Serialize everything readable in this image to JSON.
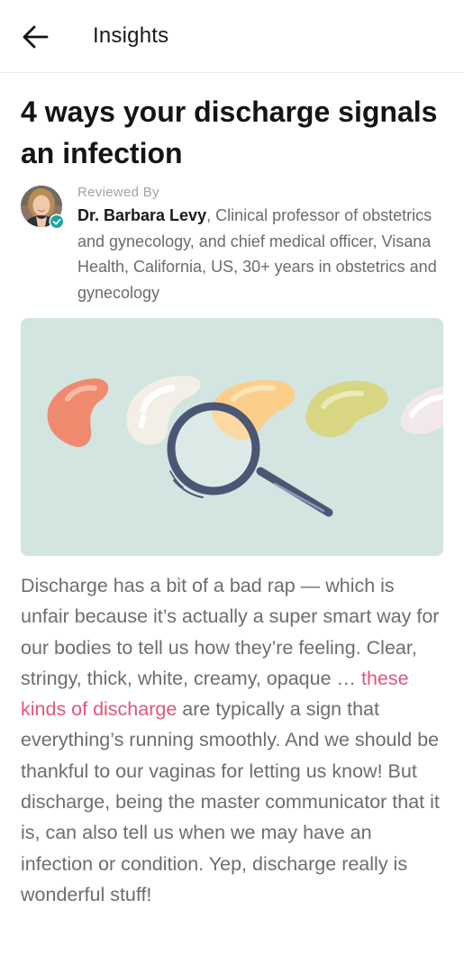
{
  "header": {
    "title": "Insights",
    "back_icon": "arrow-left-icon"
  },
  "article": {
    "title": "4 ways your discharge signals an infection",
    "reviewed_by_label": "Reviewed By",
    "reviewer_name": "Dr. Barbara Levy",
    "reviewer_credentials": ", Clinical professor of obstetrics and gynecology, and chief medical officer, Visana Health, California, US, 30+ years in obstetrics and gynecology",
    "body_part1": "Discharge has a bit of a bad rap — which is unfair because it’s actually a super smart way for our bodies to tell us how they’re feeling. Clear, stringy, thick, white, creamy, opaque … ",
    "body_link": "these kinds of discharge",
    "body_part2": " are typically a sign that everything’s running smoothly. And we should be thankful to our vaginas for letting us know! But discharge, being the master communicator that it is, can also tell us when we may have an infection or condition. Yep, discharge really is wonderful stuff!"
  },
  "colors": {
    "hero_background": "#d2e5e0",
    "link": "#e0567c",
    "verified_badge": "#1fa3a0"
  }
}
